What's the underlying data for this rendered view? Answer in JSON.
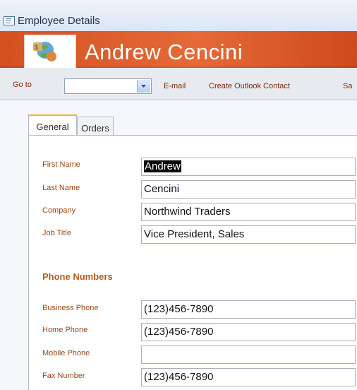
{
  "window": {
    "title": "Employee Details"
  },
  "header": {
    "name": "Andrew Cencini",
    "photo": "employee-photo-icon",
    "accent": "#d4501f"
  },
  "toolbar": {
    "goto_label": "Go to",
    "goto_value": "",
    "email": "E-mail",
    "outlook": "Create Outlook Contact",
    "save": "Sa"
  },
  "tabs": [
    "General",
    "Orders"
  ],
  "form": {
    "first_name_label": "First Name",
    "first_name": "Andrew",
    "last_name_label": "Last Name",
    "last_name": "Cencini",
    "company_label": "Company",
    "company": "Northwind Traders",
    "job_title_label": "Job Title",
    "job_title": "Vice President, Sales",
    "phone_section": "Phone Numbers",
    "business_phone_label": "Business Phone",
    "business_phone": "(123)456-7890",
    "home_phone_label": "Home Phone",
    "home_phone": "(123)456-7890",
    "mobile_phone_label": "Mobile Phone",
    "mobile_phone": "",
    "fax_number_label": "Fax Number",
    "fax_number": "(123)456-7890"
  }
}
